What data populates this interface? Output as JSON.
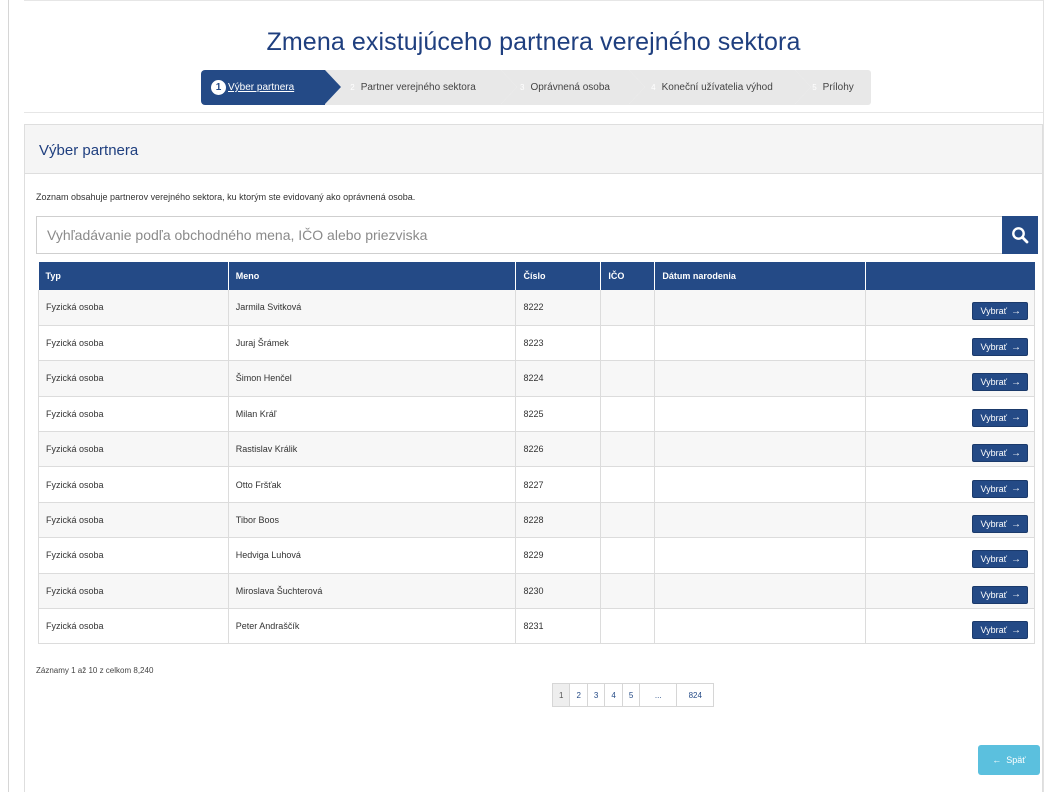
{
  "page": {
    "title": "Zmena existujúceho partnera verejného sektora"
  },
  "steps": [
    {
      "num": "1",
      "label": "Výber partnera"
    },
    {
      "num": "2",
      "label": "Partner verejného sektora"
    },
    {
      "num": "3",
      "label": "Oprávnená osoba"
    },
    {
      "num": "4",
      "label": "Koneční užívatelia výhod"
    },
    {
      "num": "5",
      "label": "Prílohy"
    }
  ],
  "panel": {
    "title": "Výber partnera",
    "intro": "Zoznam obsahuje partnerov verejného sektora, ku ktorým ste evidovaný ako oprávnená osoba."
  },
  "search": {
    "placeholder": "Vyhľadávanie podľa obchodného mena, IČO alebo priezviska",
    "icon": "search-icon"
  },
  "table": {
    "columns": [
      "Typ",
      "Meno",
      "Číslo",
      "IČO",
      "Dátum narodenia",
      ""
    ],
    "rows": [
      {
        "typ": "Fyzická osoba",
        "meno": "Jarmila Svitková",
        "cislo": "8222",
        "ico": "",
        "datum": ""
      },
      {
        "typ": "Fyzická osoba",
        "meno": "Juraj Šrámek",
        "cislo": "8223",
        "ico": "",
        "datum": ""
      },
      {
        "typ": "Fyzická osoba",
        "meno": "Šimon Henčel",
        "cislo": "8224",
        "ico": "",
        "datum": ""
      },
      {
        "typ": "Fyzická osoba",
        "meno": "Milan Kráľ",
        "cislo": "8225",
        "ico": "",
        "datum": ""
      },
      {
        "typ": "Fyzická osoba",
        "meno": "Rastislav Králik",
        "cislo": "8226",
        "ico": "",
        "datum": ""
      },
      {
        "typ": "Fyzická osoba",
        "meno": "Otto Fršťak",
        "cislo": "8227",
        "ico": "",
        "datum": ""
      },
      {
        "typ": "Fyzická osoba",
        "meno": "Tibor Boos",
        "cislo": "8228",
        "ico": "",
        "datum": ""
      },
      {
        "typ": "Fyzická osoba",
        "meno": "Hedviga Luhová",
        "cislo": "8229",
        "ico": "",
        "datum": ""
      },
      {
        "typ": "Fyzická osoba",
        "meno": "Miroslava Šuchterová",
        "cislo": "8230",
        "ico": "",
        "datum": ""
      },
      {
        "typ": "Fyzická osoba",
        "meno": "Peter Andraščík",
        "cislo": "8231",
        "ico": "",
        "datum": ""
      }
    ],
    "select_label": "Vybrať"
  },
  "records_info": "Záznamy 1 až 10 z celkom 8,240",
  "pagination": [
    "1",
    "2",
    "3",
    "4",
    "5",
    "...",
    "824"
  ],
  "back_label": "Späť",
  "colors": {
    "primary": "#244a86",
    "title": "#1f3f7f",
    "info": "#5bc0de",
    "step_inactive": "#e8e8e8"
  }
}
